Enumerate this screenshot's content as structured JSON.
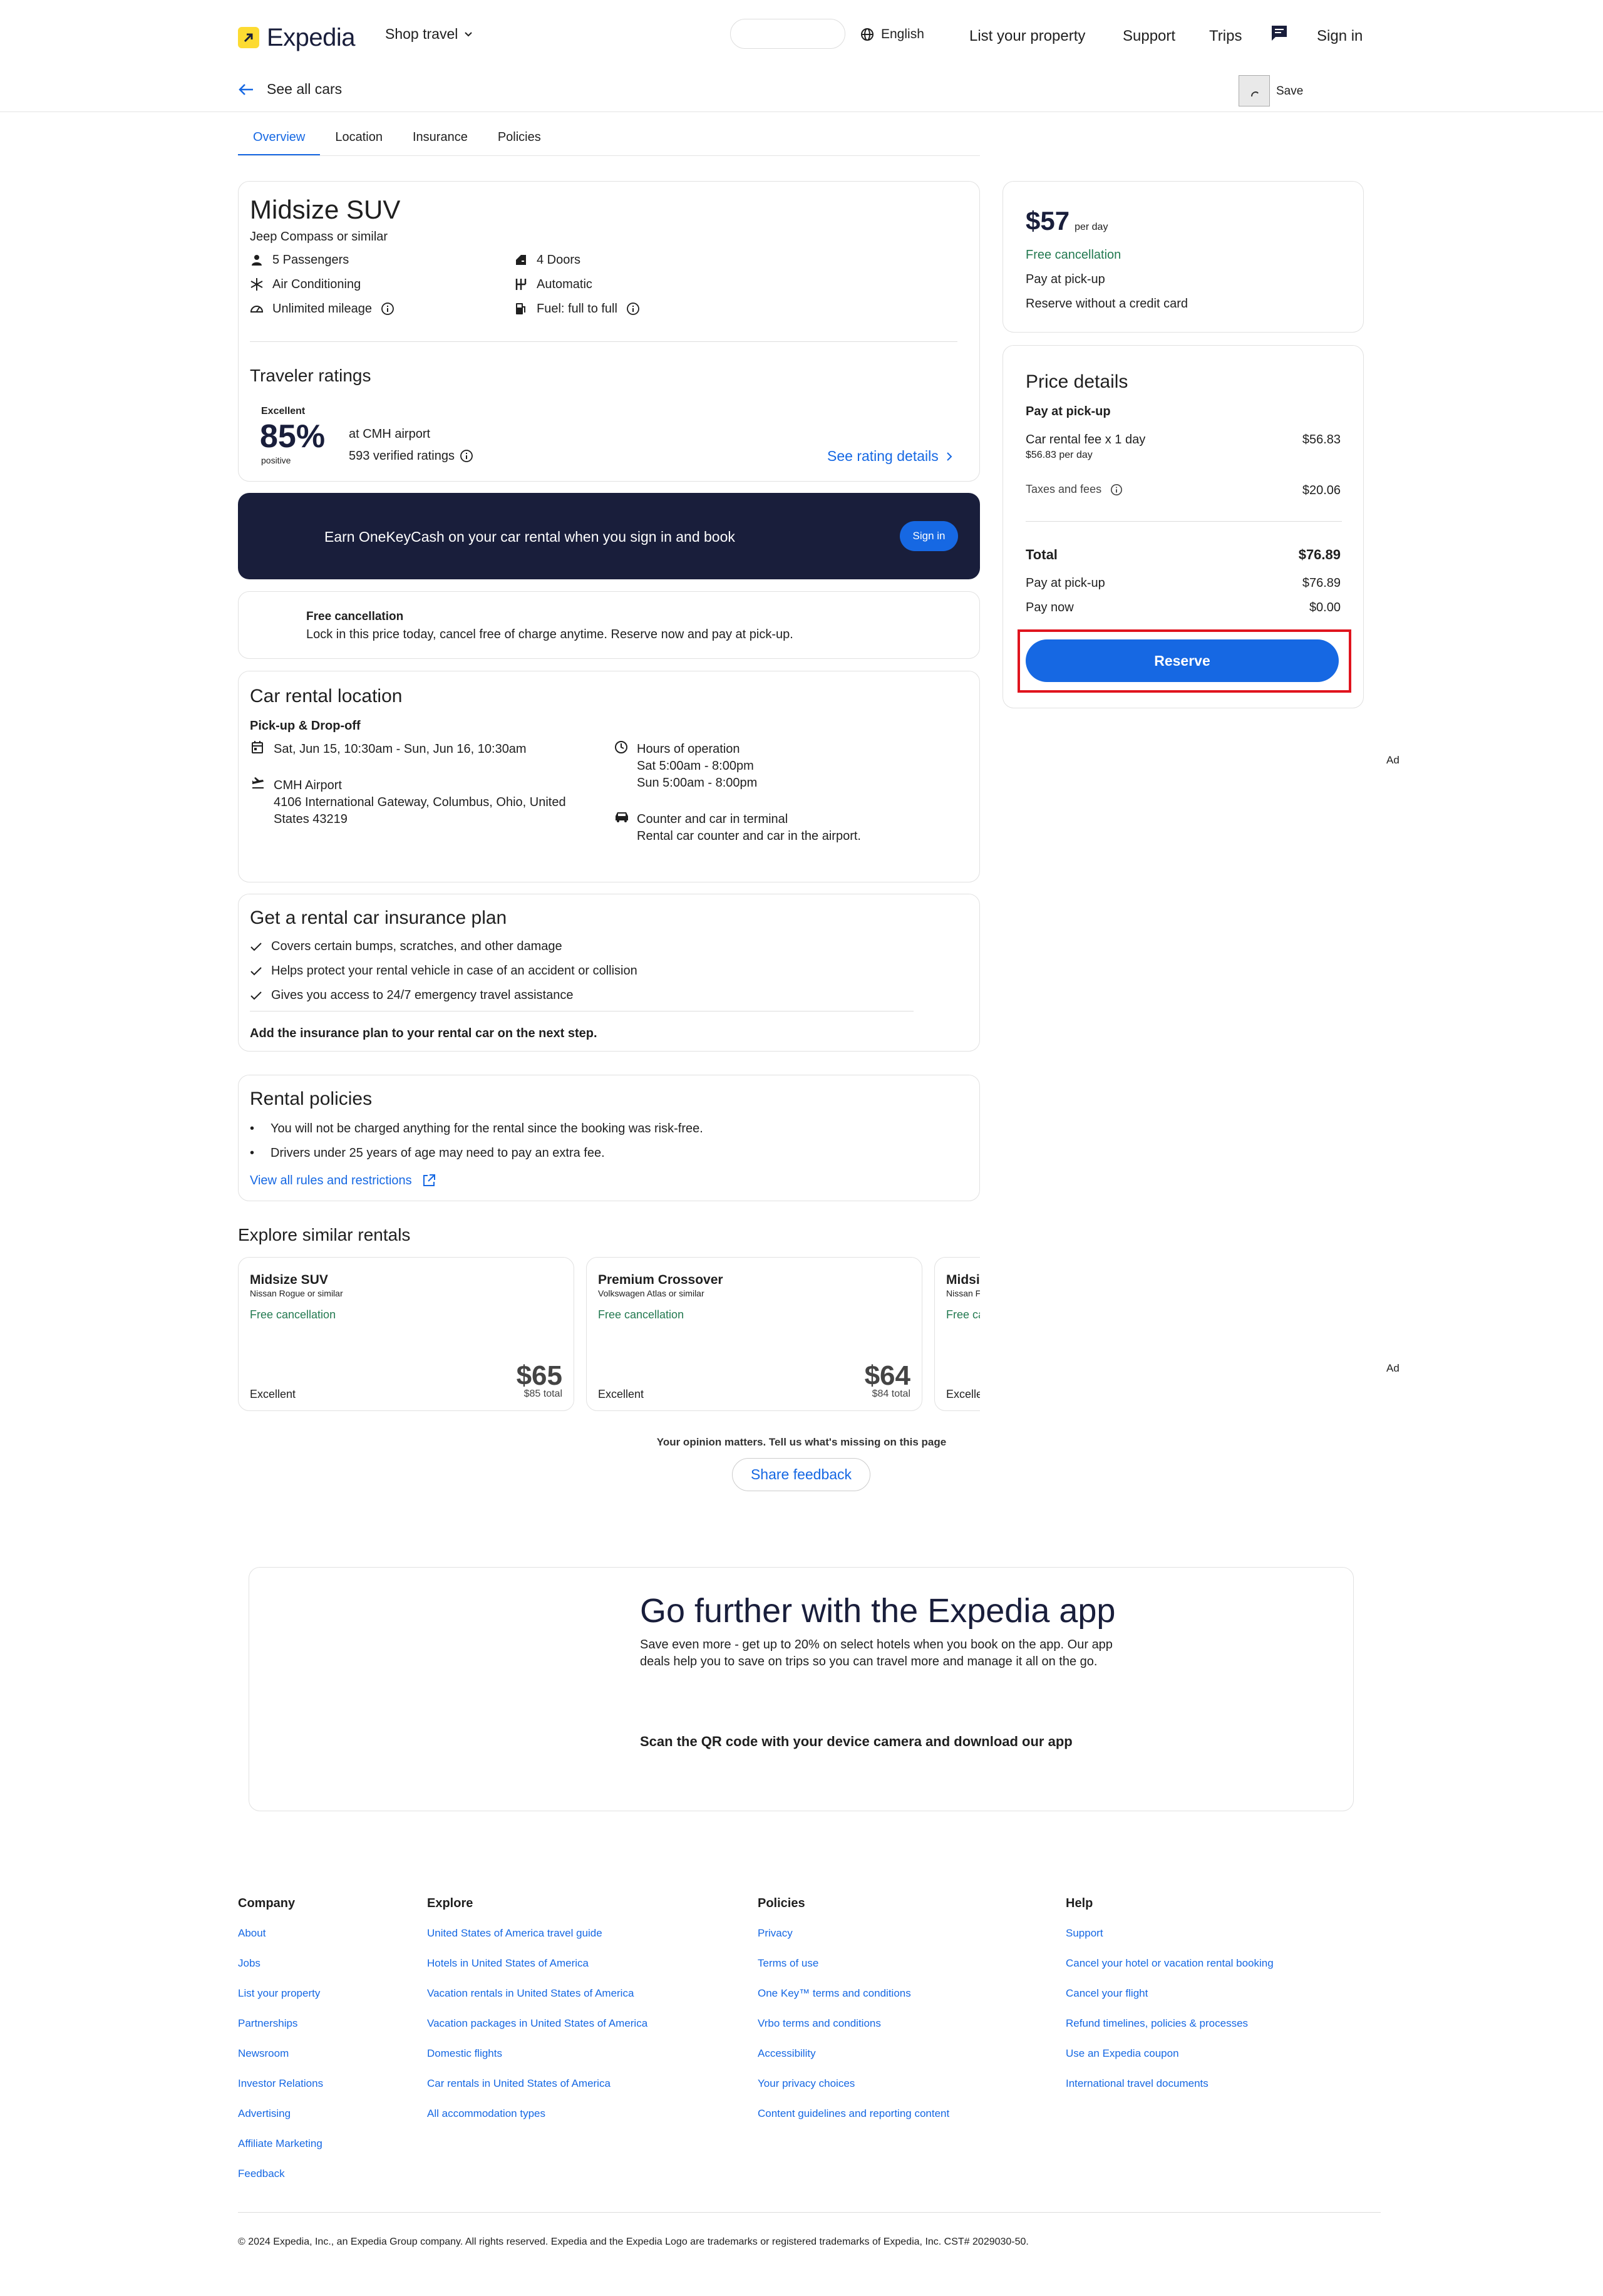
{
  "header": {
    "brand": "Expedia",
    "shop_travel": "Shop travel",
    "language": "English",
    "nav": [
      "List your property",
      "Support",
      "Trips",
      "Sign in"
    ]
  },
  "subheader": {
    "back_label": "See all cars",
    "save_label": "Save"
  },
  "tabs": [
    {
      "label": "Overview",
      "active": true
    },
    {
      "label": "Location"
    },
    {
      "label": "Insurance"
    },
    {
      "label": "Policies"
    }
  ],
  "car": {
    "title": "Midsize SUV",
    "subtitle": "Jeep Compass or similar",
    "features_left": [
      {
        "icon": "person-icon",
        "label": "5 Passengers"
      },
      {
        "icon": "snowflake-icon",
        "label": "Air Conditioning"
      },
      {
        "icon": "speedometer-icon",
        "label": "Unlimited mileage"
      }
    ],
    "features_right": [
      {
        "icon": "door-icon",
        "label": "4 Doors"
      },
      {
        "icon": "gearshift-icon",
        "label": "Automatic"
      },
      {
        "icon": "fuel-icon",
        "label": "Fuel: full to full"
      }
    ]
  },
  "ratings": {
    "heading": "Traveler ratings",
    "badge": "Excellent",
    "percent": "85%",
    "positive": "positive",
    "location": "at CMH airport",
    "count": "593 verified ratings",
    "details_link": "See rating details"
  },
  "promo": {
    "text": "Earn OneKeyCash on your car rental when you sign in and book",
    "button": "Sign in"
  },
  "cancellation": {
    "title": "Free cancellation",
    "text": "Lock in this price today, cancel free of charge anytime. Reserve now and pay at pick-up."
  },
  "location": {
    "heading": "Car rental location",
    "subheading": "Pick-up & Drop-off",
    "dates": "Sat, Jun 15, 10:30am - Sun, Jun 16, 10:30am",
    "airport_name": "CMH Airport",
    "address_line1": "4106 International Gateway, Columbus, Ohio, United",
    "address_line2": "States 43219",
    "hours_title": "Hours of operation",
    "hours_sat": "Sat 5:00am - 8:00pm",
    "hours_sun": "Sun 5:00am - 8:00pm",
    "counter_title": "Counter and car in terminal",
    "counter_text": "Rental car counter and car in the airport."
  },
  "insurance": {
    "heading": "Get a rental car insurance plan",
    "items": [
      "Covers certain bumps, scratches, and other damage",
      "Helps protect your rental vehicle in case of an accident or collision",
      "Gives you access to 24/7 emergency travel assistance"
    ],
    "footer": "Add the insurance plan to your rental car on the next step."
  },
  "policies": {
    "heading": "Rental policies",
    "items": [
      "You will not be charged anything for the rental since the booking was risk-free.",
      "Drivers under 25 years of age may need to pay an extra fee."
    ],
    "link": "View all rules and restrictions"
  },
  "similar": {
    "heading": "Explore similar rentals",
    "cards": [
      {
        "title": "Midsize SUV",
        "sub": "Nissan Rogue or similar",
        "cancel": "Free cancellation",
        "rating": "Excellent",
        "price": "$65",
        "total": "$85 total"
      },
      {
        "title": "Premium Crossover",
        "sub": "Volkswagen Atlas or similar",
        "cancel": "Free cancellation",
        "rating": "Excellent",
        "price": "$64",
        "total": "$84 total"
      },
      {
        "title": "Midsi",
        "sub": "Nissan F",
        "cancel": "Free ca",
        "rating": "Excelle",
        "price": "",
        "total": ""
      }
    ]
  },
  "feedback": {
    "prompt": "Your opinion matters. Tell us what's missing on this page",
    "button": "Share feedback"
  },
  "price_summary": {
    "price": "$57",
    "per": "per day",
    "free_cancel": "Free cancellation",
    "pay_pickup": "Pay at pick-up",
    "no_card": "Reserve without a credit card"
  },
  "price_details": {
    "heading": "Price details",
    "pay_at_pickup_title": "Pay at pick-up",
    "fee_label": "Car rental fee x 1 day",
    "fee_sub": "$56.83 per day",
    "fee_value": "$56.83",
    "taxes_label": "Taxes and fees",
    "taxes_value": "$20.06",
    "total_label": "Total",
    "total_value": "$76.89",
    "pickup_label": "Pay at pick-up",
    "pickup_value": "$76.89",
    "now_label": "Pay now",
    "now_value": "$0.00",
    "reserve": "Reserve"
  },
  "ads": [
    "Ad",
    "Ad"
  ],
  "app_promo": {
    "heading": "Go further with the Expedia app",
    "text": "Save even more - get up to 20% on select hotels when you book on the app. Our app deals help you to save on trips so you can travel more and manage it all on the go.",
    "scan": "Scan the QR code with your device camera and download our app"
  },
  "footer": {
    "columns": [
      {
        "title": "Company",
        "links": [
          "About",
          "Jobs",
          "List your property",
          "Partnerships",
          "Newsroom",
          "Investor Relations",
          "Advertising",
          "Affiliate Marketing",
          "Feedback"
        ]
      },
      {
        "title": "Explore",
        "links": [
          "United States of America travel guide",
          "Hotels in United States of America",
          "Vacation rentals in United States of America",
          "Vacation packages in United States of America",
          "Domestic flights",
          "Car rentals in United States of America",
          "All accommodation types"
        ]
      },
      {
        "title": "Policies",
        "links": [
          "Privacy",
          "Terms of use",
          "One Key™ terms and conditions",
          "Vrbo terms and conditions",
          "Accessibility",
          "Your privacy choices",
          "Content guidelines and reporting content"
        ]
      },
      {
        "title": "Help",
        "links": [
          "Support",
          "Cancel your hotel or vacation rental booking",
          "Cancel your flight",
          "Refund timelines, policies & processes",
          "Use an Expedia coupon",
          "International travel documents"
        ]
      }
    ],
    "copyright": "© 2024 Expedia, Inc., an Expedia Group company. All rights reserved. Expedia and the Expedia Logo are trademarks or registered trademarks of Expedia, Inc. CST# 2029030-50."
  }
}
